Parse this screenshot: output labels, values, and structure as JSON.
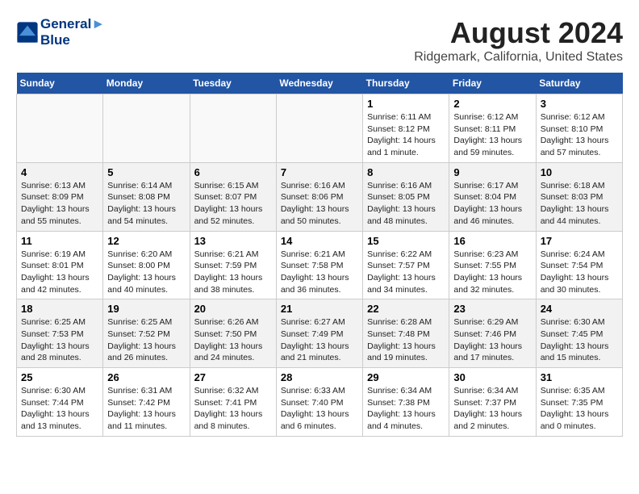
{
  "header": {
    "logo_line1": "General",
    "logo_line2": "Blue",
    "main_title": "August 2024",
    "subtitle": "Ridgemark, California, United States"
  },
  "days_of_week": [
    "Sunday",
    "Monday",
    "Tuesday",
    "Wednesday",
    "Thursday",
    "Friday",
    "Saturday"
  ],
  "weeks": [
    [
      {
        "day": "",
        "info": ""
      },
      {
        "day": "",
        "info": ""
      },
      {
        "day": "",
        "info": ""
      },
      {
        "day": "",
        "info": ""
      },
      {
        "day": "1",
        "info": "Sunrise: 6:11 AM\nSunset: 8:12 PM\nDaylight: 14 hours and 1 minute."
      },
      {
        "day": "2",
        "info": "Sunrise: 6:12 AM\nSunset: 8:11 PM\nDaylight: 13 hours and 59 minutes."
      },
      {
        "day": "3",
        "info": "Sunrise: 6:12 AM\nSunset: 8:10 PM\nDaylight: 13 hours and 57 minutes."
      }
    ],
    [
      {
        "day": "4",
        "info": "Sunrise: 6:13 AM\nSunset: 8:09 PM\nDaylight: 13 hours and 55 minutes."
      },
      {
        "day": "5",
        "info": "Sunrise: 6:14 AM\nSunset: 8:08 PM\nDaylight: 13 hours and 54 minutes."
      },
      {
        "day": "6",
        "info": "Sunrise: 6:15 AM\nSunset: 8:07 PM\nDaylight: 13 hours and 52 minutes."
      },
      {
        "day": "7",
        "info": "Sunrise: 6:16 AM\nSunset: 8:06 PM\nDaylight: 13 hours and 50 minutes."
      },
      {
        "day": "8",
        "info": "Sunrise: 6:16 AM\nSunset: 8:05 PM\nDaylight: 13 hours and 48 minutes."
      },
      {
        "day": "9",
        "info": "Sunrise: 6:17 AM\nSunset: 8:04 PM\nDaylight: 13 hours and 46 minutes."
      },
      {
        "day": "10",
        "info": "Sunrise: 6:18 AM\nSunset: 8:03 PM\nDaylight: 13 hours and 44 minutes."
      }
    ],
    [
      {
        "day": "11",
        "info": "Sunrise: 6:19 AM\nSunset: 8:01 PM\nDaylight: 13 hours and 42 minutes."
      },
      {
        "day": "12",
        "info": "Sunrise: 6:20 AM\nSunset: 8:00 PM\nDaylight: 13 hours and 40 minutes."
      },
      {
        "day": "13",
        "info": "Sunrise: 6:21 AM\nSunset: 7:59 PM\nDaylight: 13 hours and 38 minutes."
      },
      {
        "day": "14",
        "info": "Sunrise: 6:21 AM\nSunset: 7:58 PM\nDaylight: 13 hours and 36 minutes."
      },
      {
        "day": "15",
        "info": "Sunrise: 6:22 AM\nSunset: 7:57 PM\nDaylight: 13 hours and 34 minutes."
      },
      {
        "day": "16",
        "info": "Sunrise: 6:23 AM\nSunset: 7:55 PM\nDaylight: 13 hours and 32 minutes."
      },
      {
        "day": "17",
        "info": "Sunrise: 6:24 AM\nSunset: 7:54 PM\nDaylight: 13 hours and 30 minutes."
      }
    ],
    [
      {
        "day": "18",
        "info": "Sunrise: 6:25 AM\nSunset: 7:53 PM\nDaylight: 13 hours and 28 minutes."
      },
      {
        "day": "19",
        "info": "Sunrise: 6:25 AM\nSunset: 7:52 PM\nDaylight: 13 hours and 26 minutes."
      },
      {
        "day": "20",
        "info": "Sunrise: 6:26 AM\nSunset: 7:50 PM\nDaylight: 13 hours and 24 minutes."
      },
      {
        "day": "21",
        "info": "Sunrise: 6:27 AM\nSunset: 7:49 PM\nDaylight: 13 hours and 21 minutes."
      },
      {
        "day": "22",
        "info": "Sunrise: 6:28 AM\nSunset: 7:48 PM\nDaylight: 13 hours and 19 minutes."
      },
      {
        "day": "23",
        "info": "Sunrise: 6:29 AM\nSunset: 7:46 PM\nDaylight: 13 hours and 17 minutes."
      },
      {
        "day": "24",
        "info": "Sunrise: 6:30 AM\nSunset: 7:45 PM\nDaylight: 13 hours and 15 minutes."
      }
    ],
    [
      {
        "day": "25",
        "info": "Sunrise: 6:30 AM\nSunset: 7:44 PM\nDaylight: 13 hours and 13 minutes."
      },
      {
        "day": "26",
        "info": "Sunrise: 6:31 AM\nSunset: 7:42 PM\nDaylight: 13 hours and 11 minutes."
      },
      {
        "day": "27",
        "info": "Sunrise: 6:32 AM\nSunset: 7:41 PM\nDaylight: 13 hours and 8 minutes."
      },
      {
        "day": "28",
        "info": "Sunrise: 6:33 AM\nSunset: 7:40 PM\nDaylight: 13 hours and 6 minutes."
      },
      {
        "day": "29",
        "info": "Sunrise: 6:34 AM\nSunset: 7:38 PM\nDaylight: 13 hours and 4 minutes."
      },
      {
        "day": "30",
        "info": "Sunrise: 6:34 AM\nSunset: 7:37 PM\nDaylight: 13 hours and 2 minutes."
      },
      {
        "day": "31",
        "info": "Sunrise: 6:35 AM\nSunset: 7:35 PM\nDaylight: 13 hours and 0 minutes."
      }
    ]
  ]
}
